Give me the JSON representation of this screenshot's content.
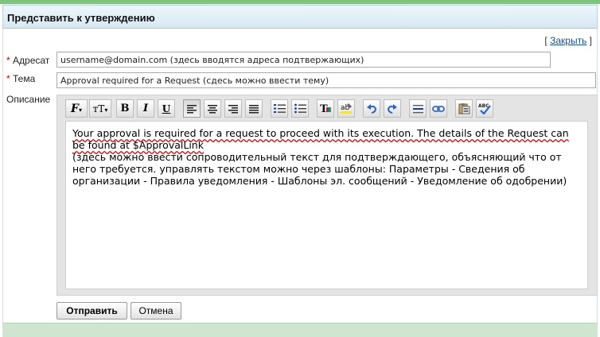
{
  "header": {
    "title": "Представить к утверждению"
  },
  "close": {
    "bracket_open": "[",
    "label": "Закрыть",
    "bracket_close": "]"
  },
  "form": {
    "to": {
      "required_mark": "*",
      "label": "Адресат",
      "value": "username@domain.com (здесь вводятся адреса подтвержающих)"
    },
    "subject": {
      "required_mark": "*",
      "label": "Тема",
      "value": "Approval required for a Request (сдесь можно ввести тему)"
    },
    "description": {
      "label": "Описание"
    }
  },
  "toolbar": {
    "buttons": [
      {
        "name": "font-family-icon",
        "glyph": "F"
      },
      {
        "name": "font-size-icon",
        "glyph": "rT"
      },
      {
        "name": "bold-icon",
        "glyph": "B"
      },
      {
        "name": "italic-icon",
        "glyph": "I"
      },
      {
        "name": "underline-icon",
        "glyph": "U"
      },
      {
        "name": "align-left-icon",
        "glyph": ""
      },
      {
        "name": "align-center-icon",
        "glyph": ""
      },
      {
        "name": "align-right-icon",
        "glyph": ""
      },
      {
        "name": "justify-icon",
        "glyph": ""
      },
      {
        "name": "ordered-list-icon",
        "glyph": ""
      },
      {
        "name": "unordered-list-icon",
        "glyph": ""
      },
      {
        "name": "text-color-icon",
        "glyph": "T"
      },
      {
        "name": "highlight-color-icon",
        "glyph": "ab"
      },
      {
        "name": "undo-icon",
        "glyph": ""
      },
      {
        "name": "redo-icon",
        "glyph": ""
      },
      {
        "name": "horizontal-rule-icon",
        "glyph": ""
      },
      {
        "name": "link-icon",
        "glyph": ""
      },
      {
        "name": "paste-icon",
        "glyph": ""
      },
      {
        "name": "spellcheck-icon",
        "glyph": "ABC"
      }
    ]
  },
  "editor": {
    "line1": "Your approval is required for a request to proceed with its execution. The details of the Request can be found at $ApprovalLink",
    "line2": "(здесь можно ввести сопроводительный текст для подтверждающего, объясняющий что от него требуется. управлять текстом можно через шаблоны: Параметры - Сведения об организации - Правила уведомления - Шаблоны эл. сообщений - Уведомление об одобрении)"
  },
  "actions": {
    "submit_label": "Отправить",
    "cancel_label": "Отмена"
  }
}
